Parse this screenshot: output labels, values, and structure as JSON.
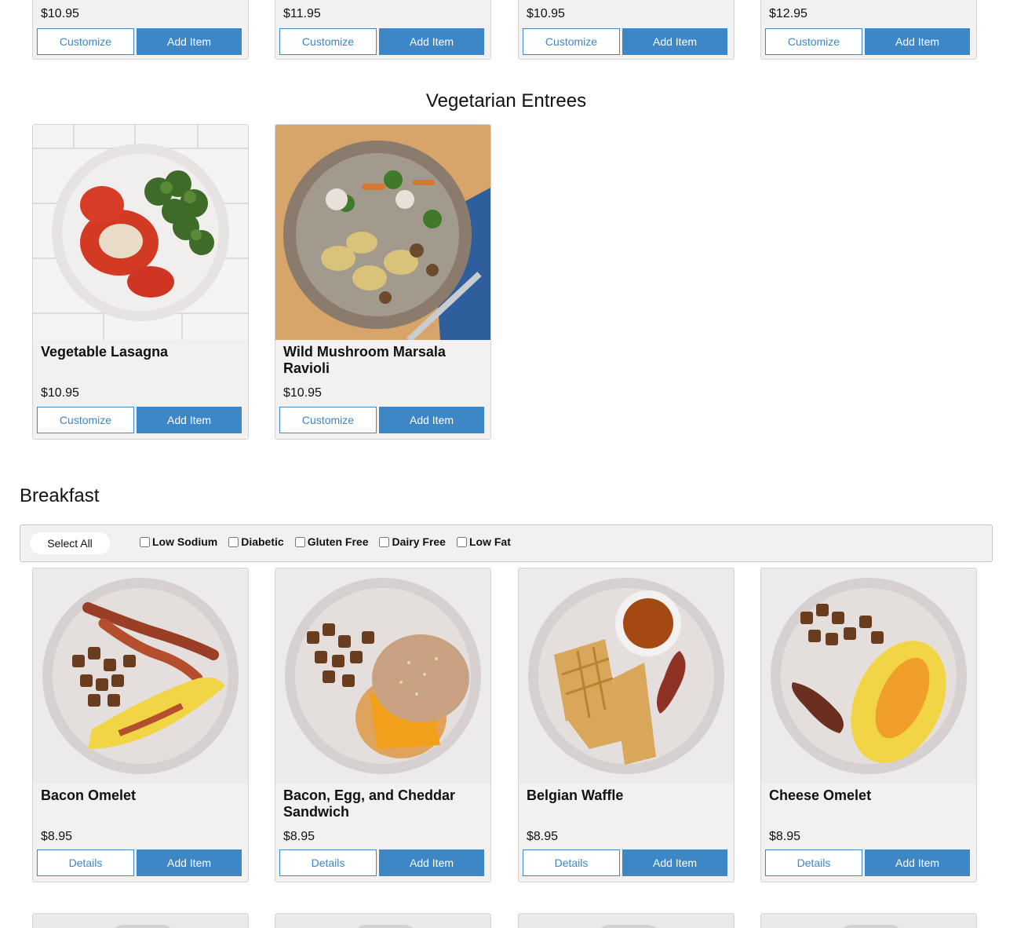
{
  "top_row": [
    {
      "price": "$10.95",
      "btn1": "Customize",
      "btn2": "Add Item"
    },
    {
      "price": "$11.95",
      "btn1": "Customize",
      "btn2": "Add Item"
    },
    {
      "price": "$10.95",
      "btn1": "Customize",
      "btn2": "Add Item"
    },
    {
      "price": "$12.95",
      "btn1": "Customize",
      "btn2": "Add Item"
    }
  ],
  "vegetarian": {
    "title": "Vegetarian Entrees",
    "items": [
      {
        "name": "Vegetable Lasagna",
        "price": "$10.95",
        "btn1": "Customize",
        "btn2": "Add Item"
      },
      {
        "name": "Wild Mushroom Marsala Ravioli",
        "price": "$10.95",
        "btn1": "Customize",
        "btn2": "Add Item"
      }
    ]
  },
  "breakfast": {
    "title": "Breakfast",
    "select_all": "Select All",
    "filters": [
      "Low Sodium",
      "Diabetic",
      "Gluten Free",
      "Dairy Free",
      "Low Fat"
    ],
    "items": [
      {
        "name": "Bacon Omelet",
        "price": "$8.95",
        "btn1": "Details",
        "btn2": "Add Item"
      },
      {
        "name": "Bacon, Egg, and Cheddar Sandwich",
        "price": "$8.95",
        "btn1": "Details",
        "btn2": "Add Item"
      },
      {
        "name": "Belgian Waffle",
        "price": "$8.95",
        "btn1": "Details",
        "btn2": "Add Item"
      },
      {
        "name": "Cheese Omelet",
        "price": "$8.95",
        "btn1": "Details",
        "btn2": "Add Item"
      }
    ]
  },
  "colors": {
    "accent": "#3d87c7",
    "card_bg": "#f2f1f0"
  }
}
